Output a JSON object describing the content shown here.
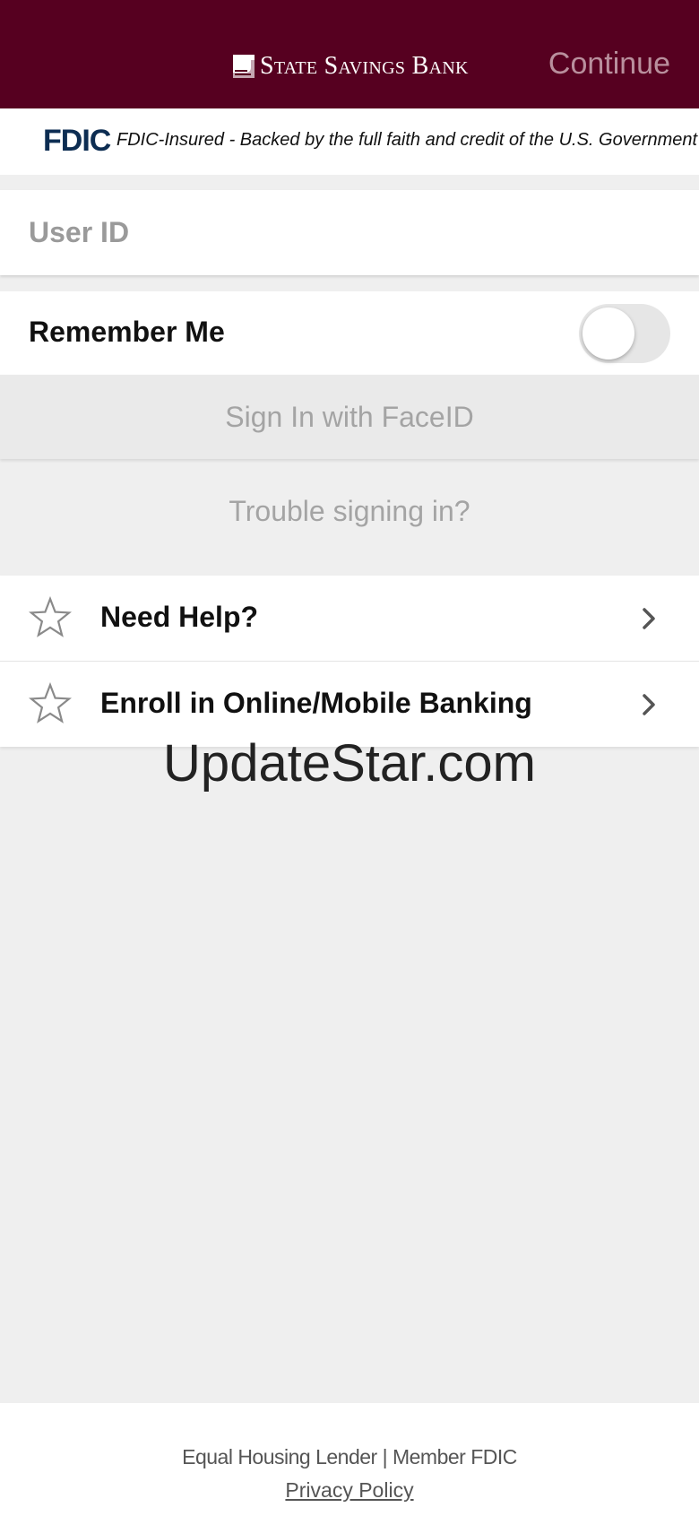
{
  "header": {
    "bank_name": "State Savings Bank",
    "continue_label": "Continue",
    "background_color": "#560020"
  },
  "fdic": {
    "logo_text": "FDIC",
    "notice": "FDIC-Insured - Backed by the full faith and credit of the U.S. Government"
  },
  "login": {
    "userid_placeholder": "User ID",
    "userid_value": "",
    "remember_label": "Remember Me",
    "remember_on": false,
    "faceid_label": "Sign In with FaceID",
    "trouble_label": "Trouble signing in?"
  },
  "menu": {
    "items": [
      {
        "label": "Need Help?",
        "icon": "star-outline-icon"
      },
      {
        "label": "Enroll in Online/Mobile Banking",
        "icon": "star-outline-icon"
      }
    ]
  },
  "watermark": "UpdateStar.com",
  "footer": {
    "text": "Equal Housing Lender | Member FDIC",
    "privacy_label": "Privacy Policy"
  }
}
